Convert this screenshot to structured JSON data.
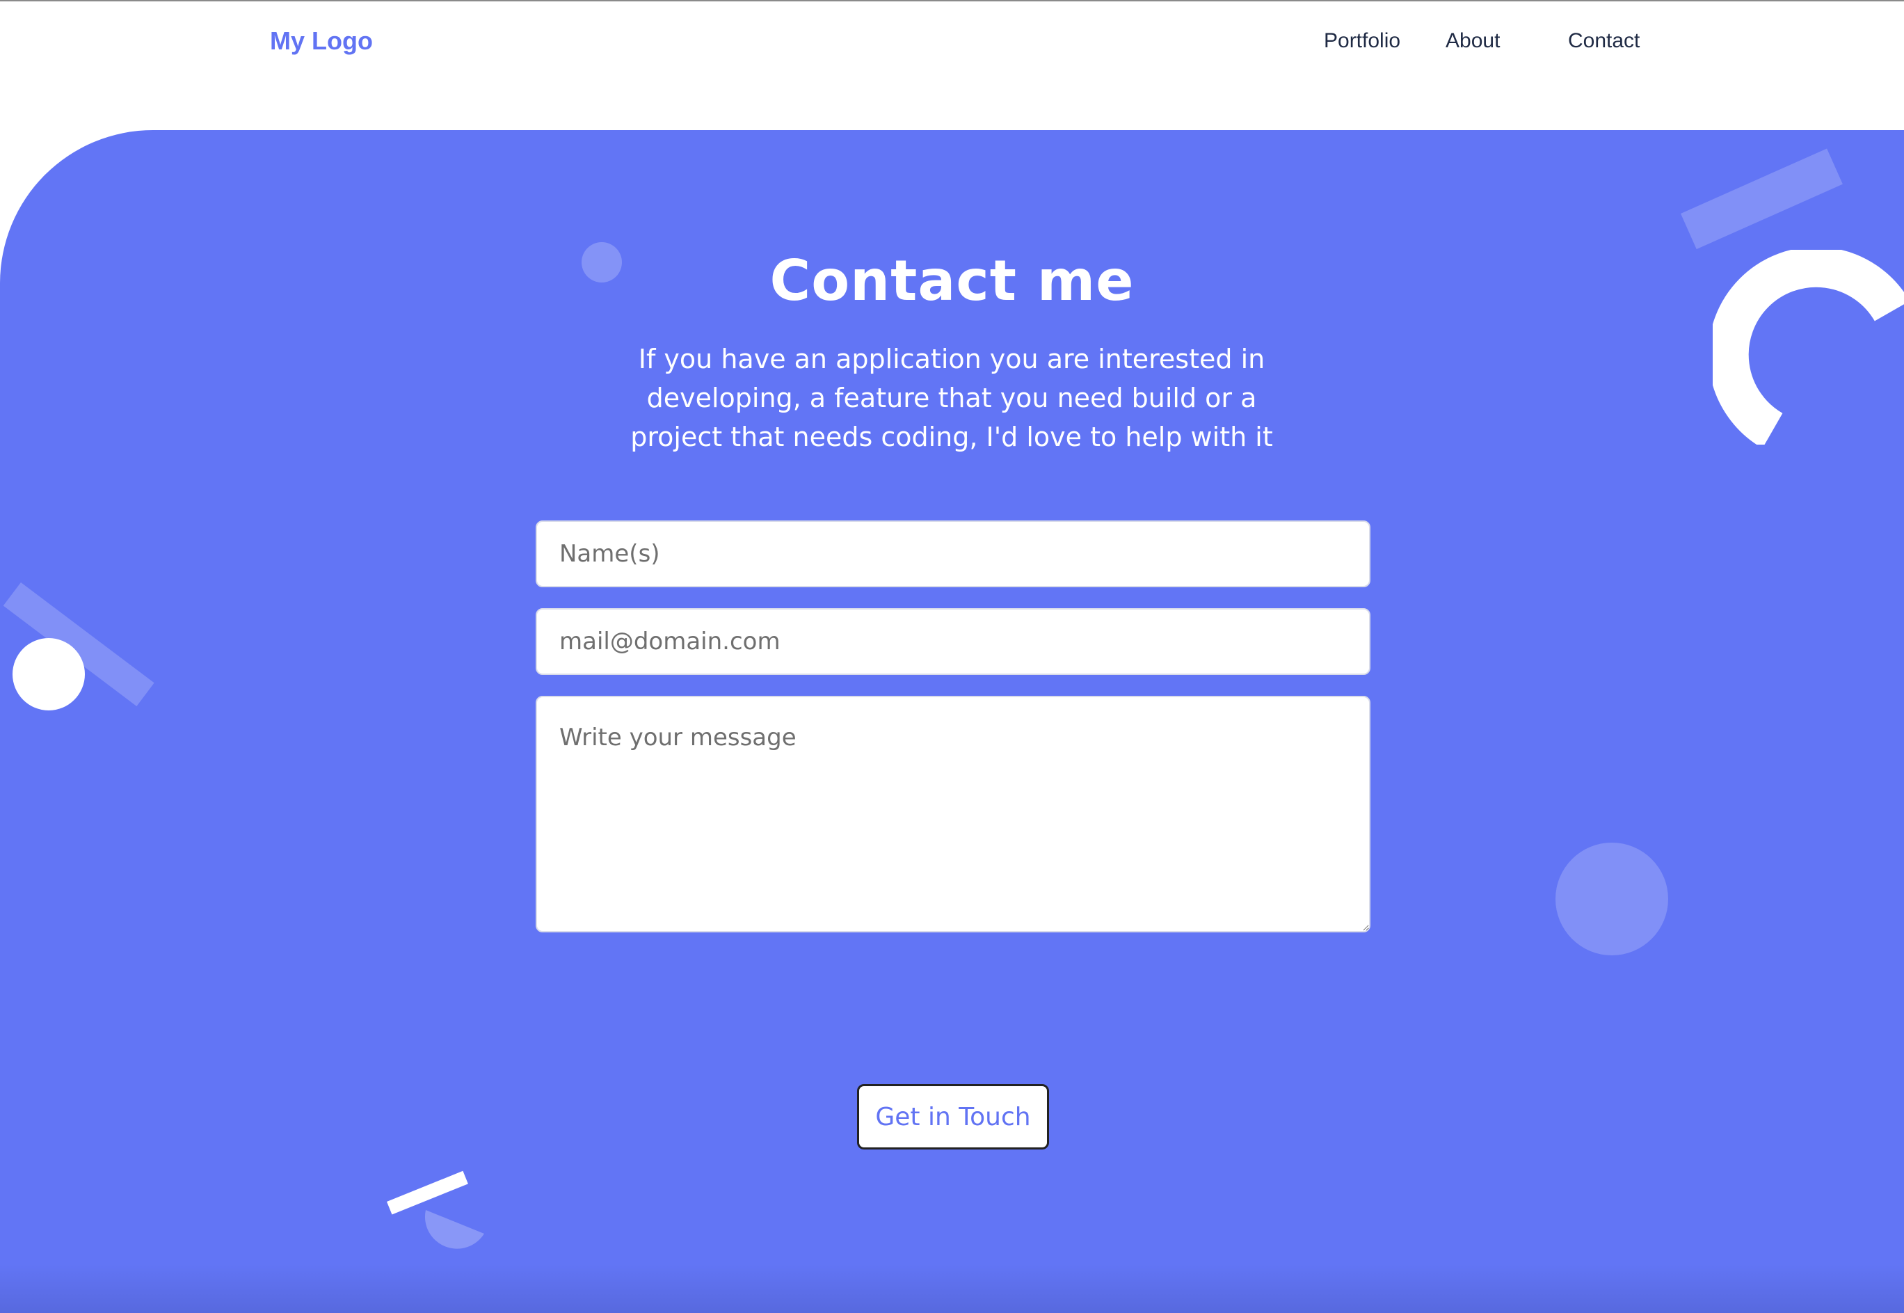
{
  "header": {
    "logo": "My Logo",
    "nav": [
      {
        "label": "Portfolio"
      },
      {
        "label": "About"
      },
      {
        "label": "Contact"
      }
    ]
  },
  "contact": {
    "title": "Contact me",
    "subtitle": "If you have an application you are interested in developing, a feature that you need build or a project that needs coding, I'd love to help with it",
    "form": {
      "name_placeholder": "Name(s)",
      "email_placeholder": "mail@domain.com",
      "message_placeholder": "Write your message",
      "submit_label": "Get in Touch"
    }
  },
  "colors": {
    "accent": "#6275f5",
    "logo": "#6173f3",
    "nav_text": "#1f2a44",
    "background": "#ffffff"
  }
}
